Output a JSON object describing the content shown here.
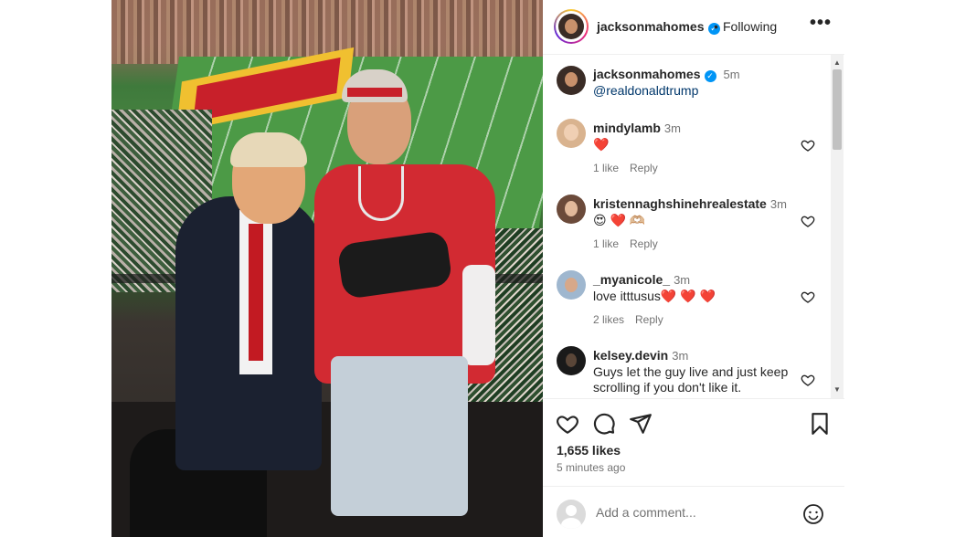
{
  "header": {
    "username": "jacksonmahomes",
    "dot": "•",
    "follow_status": "Following",
    "more_label": "•••"
  },
  "comments": [
    {
      "username": "jacksonmahomes",
      "time": "5m",
      "text": "@realdonaldtrump",
      "verified": true,
      "likes": "",
      "reply": ""
    },
    {
      "username": "mindylamb",
      "time": "3m",
      "text": "❤️",
      "likes": "1 like",
      "reply": "Reply"
    },
    {
      "username": "kristennaghshinehrealestate",
      "time": "3m",
      "text": "😍 ❤️ 🫶🏼",
      "likes": "1 like",
      "reply": "Reply"
    },
    {
      "username": "_myanicole_",
      "time": "3m",
      "text": "love itttusus❤️ ❤️ ❤️",
      "likes": "2 likes",
      "reply": "Reply"
    },
    {
      "username": "kelsey.devin",
      "time": "3m",
      "text": "Guys let the guy live and just keep scrolling if you don't like it.",
      "likes": "",
      "reply": ""
    }
  ],
  "actions": {
    "likes": "1,655 likes",
    "time_ago": "5 minutes ago",
    "icons": [
      "heart-icon",
      "comment-icon",
      "share-icon",
      "bookmark-icon"
    ]
  },
  "add_comment": {
    "placeholder": "Add a comment..."
  },
  "colors": {
    "verified": "#0095f6",
    "link": "#00376b",
    "heart_red": "#e8292f",
    "muted": "#737373"
  }
}
